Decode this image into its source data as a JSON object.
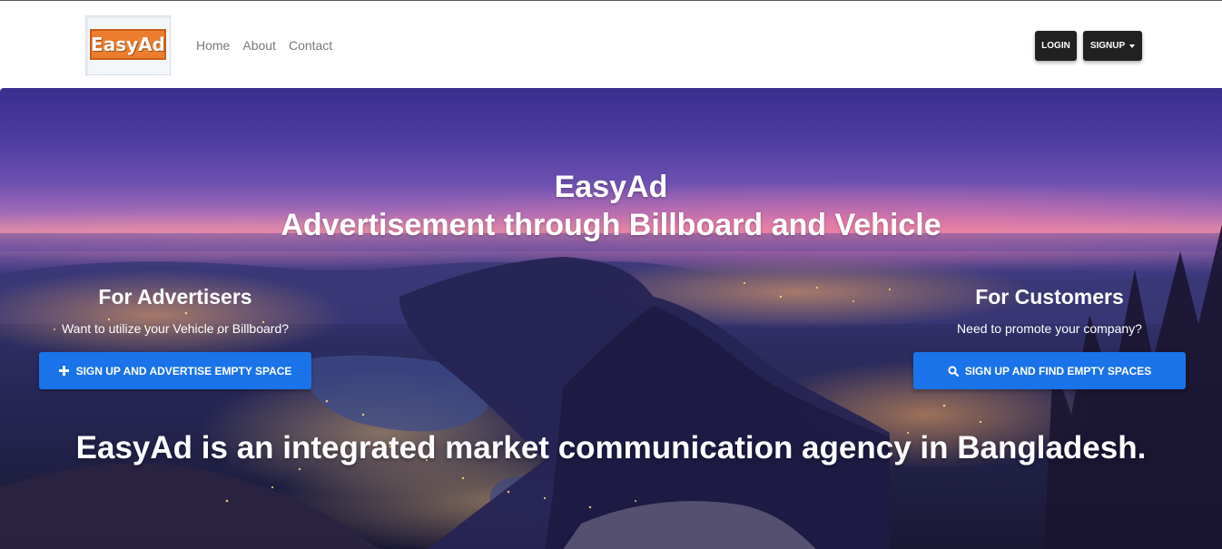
{
  "navbar": {
    "logo_text": "EasyAd",
    "links": [
      "Home",
      "About",
      "Contact"
    ],
    "login_label": "LOGIN",
    "signup_label": "SIGNUP"
  },
  "hero": {
    "title": "EasyAd",
    "subtitle": "Advertisement through Billboard and Vehicle",
    "advertisers": {
      "heading": "For Advertisers",
      "text": "Want to utilize your Vehicle or Billboard?",
      "button_label": "SIGN UP AND ADVERTISE EMPTY SPACE",
      "button_icon": "plus-icon"
    },
    "customers": {
      "heading": "For Customers",
      "text": "Need to promote your company?",
      "button_label": "SIGN UP AND FIND EMPTY SPACES",
      "button_icon": "search-icon"
    },
    "tagline": "EasyAd is an integrated market communication agency in Bangladesh."
  },
  "colors": {
    "accent_button": "#1a73e8",
    "nav_button": "#212121",
    "logo_orange": "#ec7d2e",
    "nav_link": "#7a7a7a"
  }
}
